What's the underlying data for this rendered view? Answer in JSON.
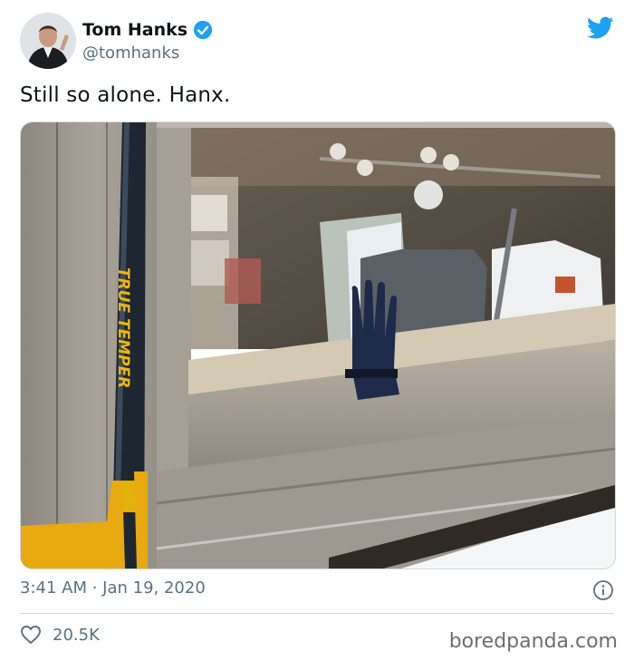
{
  "user": {
    "display_name": "Tom Hanks",
    "handle": "@tomhanks",
    "verified": true
  },
  "tweet": {
    "text": "Still so alone. Hanx.",
    "timestamp": "3:41 AM · Jan 19, 2020",
    "likes": "20.5K"
  },
  "photo": {
    "shovel_brand": "TRUE TEMPER"
  },
  "icons": {
    "brand": "twitter-bird-icon",
    "verified": "verified-badge-icon",
    "info": "info-icon",
    "like": "heart-icon"
  },
  "colors": {
    "twitter_blue": "#1da1f2",
    "secondary_text": "#5b7083"
  },
  "watermark": "boredpanda.com"
}
